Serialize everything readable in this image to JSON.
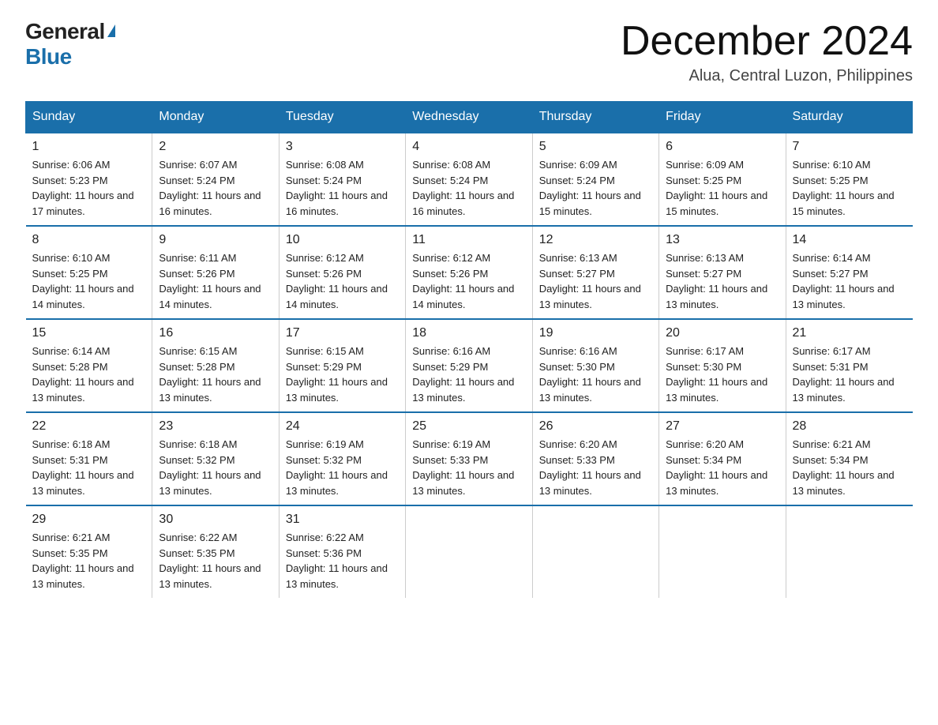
{
  "header": {
    "logo_general": "General",
    "logo_blue": "Blue",
    "month_title": "December 2024",
    "location": "Alua, Central Luzon, Philippines"
  },
  "days_of_week": [
    "Sunday",
    "Monday",
    "Tuesday",
    "Wednesday",
    "Thursday",
    "Friday",
    "Saturday"
  ],
  "weeks": [
    [
      {
        "day": "1",
        "sunrise": "6:06 AM",
        "sunset": "5:23 PM",
        "daylight": "11 hours and 17 minutes."
      },
      {
        "day": "2",
        "sunrise": "6:07 AM",
        "sunset": "5:24 PM",
        "daylight": "11 hours and 16 minutes."
      },
      {
        "day": "3",
        "sunrise": "6:08 AM",
        "sunset": "5:24 PM",
        "daylight": "11 hours and 16 minutes."
      },
      {
        "day": "4",
        "sunrise": "6:08 AM",
        "sunset": "5:24 PM",
        "daylight": "11 hours and 16 minutes."
      },
      {
        "day": "5",
        "sunrise": "6:09 AM",
        "sunset": "5:24 PM",
        "daylight": "11 hours and 15 minutes."
      },
      {
        "day": "6",
        "sunrise": "6:09 AM",
        "sunset": "5:25 PM",
        "daylight": "11 hours and 15 minutes."
      },
      {
        "day": "7",
        "sunrise": "6:10 AM",
        "sunset": "5:25 PM",
        "daylight": "11 hours and 15 minutes."
      }
    ],
    [
      {
        "day": "8",
        "sunrise": "6:10 AM",
        "sunset": "5:25 PM",
        "daylight": "11 hours and 14 minutes."
      },
      {
        "day": "9",
        "sunrise": "6:11 AM",
        "sunset": "5:26 PM",
        "daylight": "11 hours and 14 minutes."
      },
      {
        "day": "10",
        "sunrise": "6:12 AM",
        "sunset": "5:26 PM",
        "daylight": "11 hours and 14 minutes."
      },
      {
        "day": "11",
        "sunrise": "6:12 AM",
        "sunset": "5:26 PM",
        "daylight": "11 hours and 14 minutes."
      },
      {
        "day": "12",
        "sunrise": "6:13 AM",
        "sunset": "5:27 PM",
        "daylight": "11 hours and 13 minutes."
      },
      {
        "day": "13",
        "sunrise": "6:13 AM",
        "sunset": "5:27 PM",
        "daylight": "11 hours and 13 minutes."
      },
      {
        "day": "14",
        "sunrise": "6:14 AM",
        "sunset": "5:27 PM",
        "daylight": "11 hours and 13 minutes."
      }
    ],
    [
      {
        "day": "15",
        "sunrise": "6:14 AM",
        "sunset": "5:28 PM",
        "daylight": "11 hours and 13 minutes."
      },
      {
        "day": "16",
        "sunrise": "6:15 AM",
        "sunset": "5:28 PM",
        "daylight": "11 hours and 13 minutes."
      },
      {
        "day": "17",
        "sunrise": "6:15 AM",
        "sunset": "5:29 PM",
        "daylight": "11 hours and 13 minutes."
      },
      {
        "day": "18",
        "sunrise": "6:16 AM",
        "sunset": "5:29 PM",
        "daylight": "11 hours and 13 minutes."
      },
      {
        "day": "19",
        "sunrise": "6:16 AM",
        "sunset": "5:30 PM",
        "daylight": "11 hours and 13 minutes."
      },
      {
        "day": "20",
        "sunrise": "6:17 AM",
        "sunset": "5:30 PM",
        "daylight": "11 hours and 13 minutes."
      },
      {
        "day": "21",
        "sunrise": "6:17 AM",
        "sunset": "5:31 PM",
        "daylight": "11 hours and 13 minutes."
      }
    ],
    [
      {
        "day": "22",
        "sunrise": "6:18 AM",
        "sunset": "5:31 PM",
        "daylight": "11 hours and 13 minutes."
      },
      {
        "day": "23",
        "sunrise": "6:18 AM",
        "sunset": "5:32 PM",
        "daylight": "11 hours and 13 minutes."
      },
      {
        "day": "24",
        "sunrise": "6:19 AM",
        "sunset": "5:32 PM",
        "daylight": "11 hours and 13 minutes."
      },
      {
        "day": "25",
        "sunrise": "6:19 AM",
        "sunset": "5:33 PM",
        "daylight": "11 hours and 13 minutes."
      },
      {
        "day": "26",
        "sunrise": "6:20 AM",
        "sunset": "5:33 PM",
        "daylight": "11 hours and 13 minutes."
      },
      {
        "day": "27",
        "sunrise": "6:20 AM",
        "sunset": "5:34 PM",
        "daylight": "11 hours and 13 minutes."
      },
      {
        "day": "28",
        "sunrise": "6:21 AM",
        "sunset": "5:34 PM",
        "daylight": "11 hours and 13 minutes."
      }
    ],
    [
      {
        "day": "29",
        "sunrise": "6:21 AM",
        "sunset": "5:35 PM",
        "daylight": "11 hours and 13 minutes."
      },
      {
        "day": "30",
        "sunrise": "6:22 AM",
        "sunset": "5:35 PM",
        "daylight": "11 hours and 13 minutes."
      },
      {
        "day": "31",
        "sunrise": "6:22 AM",
        "sunset": "5:36 PM",
        "daylight": "11 hours and 13 minutes."
      },
      null,
      null,
      null,
      null
    ]
  ]
}
